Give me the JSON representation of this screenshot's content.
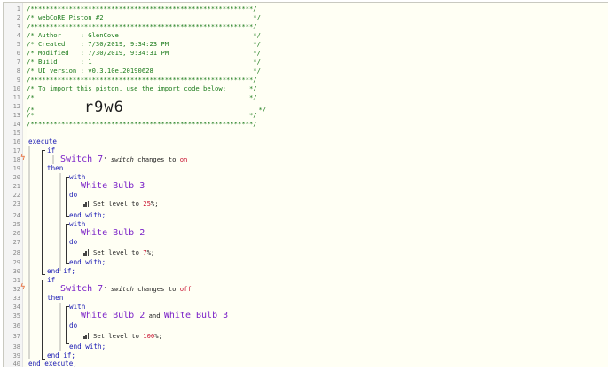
{
  "line_numbers": [
    "1",
    "2",
    "3",
    "4",
    "5",
    "6",
    "7",
    "8",
    "9",
    "10",
    "11",
    "12",
    "13",
    "14",
    "15",
    "16",
    "17",
    "18",
    "19",
    "20",
    "21",
    "22",
    "23",
    "24",
    "25",
    "26",
    "27",
    "28",
    "29",
    "30",
    "31",
    "32",
    "33",
    "34",
    "35",
    "36",
    "37",
    "38",
    "39",
    "40"
  ],
  "header_comment": {
    "l1": "/**********************************************************/",
    "l2": "/* webCoRE Piston #2                                       */",
    "l3": "/**********************************************************/",
    "l4": "/* Author     : GlenCove                                   */",
    "l5": "/* Created    : 7/30/2019, 9:34:23 PM                      */",
    "l6": "/* Modified   : 7/30/2019, 9:34:31 PM                      */",
    "l7": "/* Build      : 1                                          */",
    "l8": "/* UI version : v0.3.10e.20190628                          */",
    "l9": "/**********************************************************/",
    "l10": "/* To import this piston, use the import code below:      */",
    "l11": "/*                                                        */",
    "l12_left": "/*             ",
    "import_code": "r9w6",
    "l12_right": "                                   */",
    "l13": "/*                                                        */",
    "l14": "/**********************************************************/"
  },
  "kw": {
    "execute": "execute",
    "if": "if",
    "then": "then",
    "with": "with",
    "do": "do",
    "end_with": "end with;",
    "end_if": "end if;",
    "end_execute": "end execute;",
    "and": "and"
  },
  "trigger1": {
    "device": "Switch 7",
    "tick": "'",
    "attr": "switch",
    "op": "changes to",
    "value": "on"
  },
  "trigger2": {
    "device": "Switch 7",
    "tick": "'",
    "attr": "switch",
    "op": "changes to",
    "value": "off"
  },
  "block1": {
    "device": "White Bulb 3",
    "action": "Set level to",
    "level": "25",
    "unit": "%;"
  },
  "block2": {
    "device": "White Bulb 2",
    "action": "Set level to",
    "level": "7",
    "unit": "%;"
  },
  "block3": {
    "device_a": "White Bulb 2",
    "device_b": "White Bulb 3",
    "action": "Set level to",
    "level": "100",
    "unit": "%;"
  },
  "icons": {
    "trigger": "lightning-bolt-icon",
    "level": "signal-bars-icon"
  },
  "colors": {
    "comment": "#1a7a1a",
    "keyword": "#1a1ab4",
    "device": "#7b22c7",
    "value": "#c8102e",
    "trigger_icon": "#e8632b",
    "background": "#fffff4"
  }
}
